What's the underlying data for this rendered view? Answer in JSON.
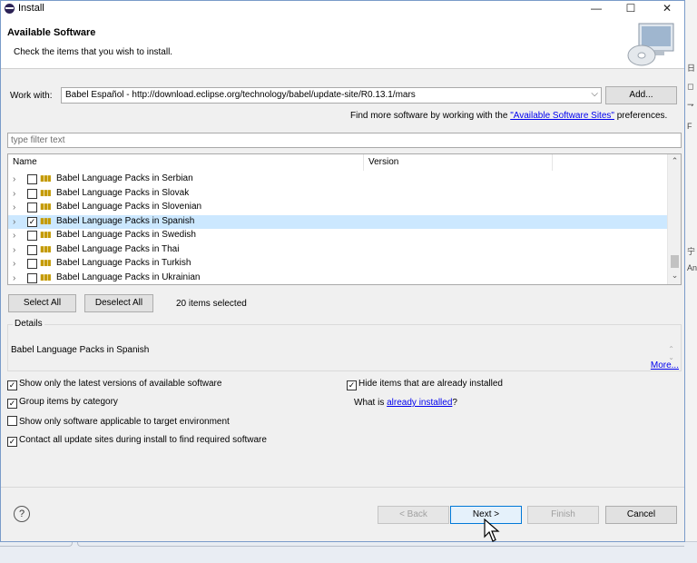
{
  "window": {
    "title": "Install",
    "minimize": "—",
    "maximize": "☐",
    "close": "✕"
  },
  "header": {
    "title": "Available Software",
    "subtitle": "Check the items that you wish to install."
  },
  "work_with": {
    "label": "Work with:",
    "value": "Babel Español - http://download.eclipse.org/technology/babel/update-site/R0.13.1/mars",
    "add_label": "Add..."
  },
  "find_more": {
    "prefix": "Find more software by working with the ",
    "link": "\"Available Software Sites\"",
    "suffix": " preferences."
  },
  "filter": {
    "placeholder": "type filter text"
  },
  "tree": {
    "columns": [
      "Name",
      "Version"
    ],
    "rows": [
      {
        "name": "Babel Language Packs in Serbian",
        "checked": false
      },
      {
        "name": "Babel Language Packs in Slovak",
        "checked": false
      },
      {
        "name": "Babel Language Packs in Slovenian",
        "checked": false
      },
      {
        "name": "Babel Language Packs in Spanish",
        "checked": true,
        "selected": true
      },
      {
        "name": "Babel Language Packs in Swedish",
        "checked": false
      },
      {
        "name": "Babel Language Packs in Thai",
        "checked": false
      },
      {
        "name": "Babel Language Packs in Turkish",
        "checked": false
      },
      {
        "name": "Babel Language Packs in Ukrainian",
        "checked": false
      }
    ]
  },
  "selection": {
    "select_all": "Select All",
    "deselect_all": "Deselect All",
    "count": "20 items selected"
  },
  "details": {
    "legend": "Details",
    "text": "Babel Language Packs in Spanish",
    "more": "More..."
  },
  "options": {
    "latest": {
      "label": "Show only the latest versions of available software",
      "checked": true
    },
    "hide_installed": {
      "label": "Hide items that are already installed",
      "checked": true
    },
    "group": {
      "label": "Group items by category",
      "checked": true
    },
    "what_is_prefix": "What is ",
    "what_is_link": "already installed",
    "what_is_suffix": "?",
    "applicable": {
      "label": "Show only software applicable to target environment",
      "checked": false
    },
    "contact": {
      "label": "Contact all update sites during install to find required software",
      "checked": true
    }
  },
  "footer": {
    "help": "?",
    "back": "< Back",
    "next": "Next >",
    "finish": "Finish",
    "cancel": "Cancel"
  },
  "background": {
    "marks": [
      "日",
      "◻",
      "⇁",
      "F",
      "宁",
      "An"
    ]
  }
}
